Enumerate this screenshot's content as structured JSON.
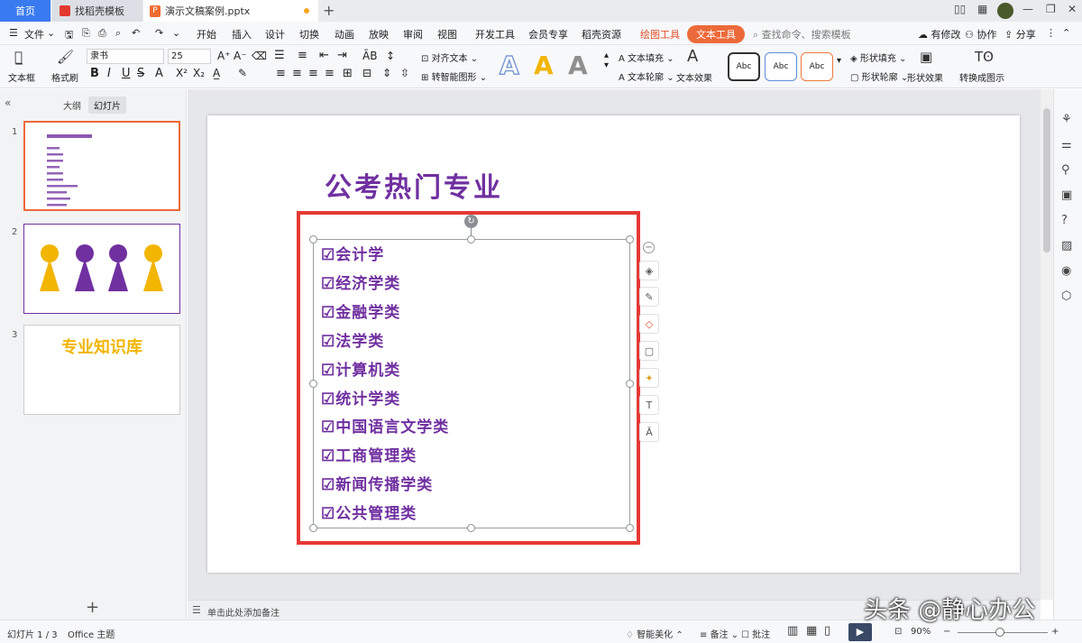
{
  "tabs": {
    "home": "首页",
    "template": "找稻壳模板",
    "document": "演示文稿案例.pptx"
  },
  "menubar": {
    "file": "文件",
    "items": [
      "开始",
      "插入",
      "设计",
      "切换",
      "动画",
      "放映",
      "审阅",
      "视图",
      "开发工具",
      "会员专享",
      "稻壳资源"
    ],
    "draw_tools": "绘图工具",
    "text_tools": "文本工具",
    "search_placeholder": "查找命令、搜索模板",
    "has_changes": "有修改",
    "collaborate": "协作",
    "share": "分享"
  },
  "ribbon": {
    "textbox": "文本框",
    "format_painter": "格式刷",
    "font": "隶书",
    "font_size": "25",
    "align_text": "对齐文本",
    "smart_art": "转智能图形",
    "text_fill": "文本填充",
    "text_outline": "文本轮廓",
    "text_effect": "文本效果",
    "style_label": "Abc",
    "shape_fill": "形状填充",
    "shape_outline": "形状轮廓",
    "shape_effect": "形状效果",
    "convert_diagram": "转换成图示",
    "colors": {
      "wordart_blue": "#9ab4e0",
      "wordart_gold": "#f2b500",
      "wordart_gray": "#9a9a9a"
    }
  },
  "leftpanel": {
    "tab_outline": "大纲",
    "tab_slides": "幻灯片",
    "slide_numbers": [
      "1",
      "2",
      "3"
    ],
    "slide3_title": "专业知识库"
  },
  "slide": {
    "title": "公考热门专业",
    "items": [
      "☑会计学",
      "☑经济学类",
      "☑金融学类",
      "☑法学类",
      "☑计算机类",
      "☑统计学类",
      "☑中国语言文学类",
      "☑工商管理类",
      "☑新闻传播学类",
      "☑公共管理类"
    ]
  },
  "notes": {
    "placeholder": "单击此处添加备注"
  },
  "status": {
    "slide_info": "幻灯片 1 / 3",
    "theme": "Office 主题",
    "beautify": "智能美化",
    "remarks": "备注",
    "comments": "批注",
    "zoom": "90%"
  },
  "watermark": "头条 @静心办公"
}
